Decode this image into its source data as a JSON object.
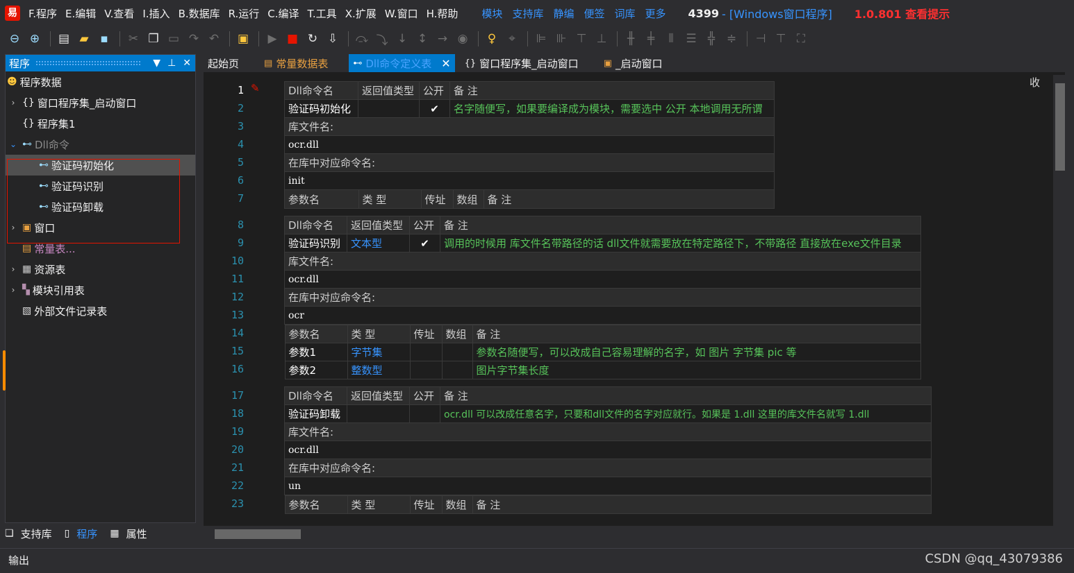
{
  "menubar": {
    "logo": "易",
    "items": [
      "F.程序",
      "E.编辑",
      "V.查看",
      "I.插入",
      "B.数据库",
      "R.运行",
      "C.编译",
      "T.工具",
      "X.扩展",
      "W.窗口",
      "H.帮助"
    ],
    "links": [
      "模块",
      "支持库",
      "静编",
      "便签",
      "词库",
      "更多"
    ],
    "title_num": "4399",
    "title_text": "- [Windows窗口程序]",
    "version": "1.0.801 查看提示"
  },
  "left_panel": {
    "title": "程序",
    "root": "程序数据",
    "items": [
      {
        "label": "窗口程序集_启动窗口",
        "icon": "{}"
      },
      {
        "label": "程序集1",
        "icon": "{}"
      },
      {
        "label": "Dll命令",
        "icon": "⊷"
      },
      {
        "label": "验证码初始化",
        "icon": "⊷"
      },
      {
        "label": "验证码识别",
        "icon": "⊷"
      },
      {
        "label": "验证码卸载",
        "icon": "⊷"
      },
      {
        "label": "窗口",
        "icon": "▣"
      },
      {
        "label": "常量表...",
        "icon": "▤"
      },
      {
        "label": "资源表",
        "icon": "▦"
      },
      {
        "label": "模块引用表",
        "icon": "▚"
      },
      {
        "label": "外部文件记录表",
        "icon": "▧"
      }
    ],
    "tabs": [
      "支持库",
      "程序",
      "属性"
    ]
  },
  "doc_tabs": [
    {
      "label": "起始页",
      "icon": ""
    },
    {
      "label": "常量数据表",
      "icon": "▤"
    },
    {
      "label": "Dll命令定义表",
      "icon": "⊷"
    },
    {
      "label": "窗口程序集_启动窗口",
      "icon": "{}"
    },
    {
      "label": "_启动窗口",
      "icon": "▣"
    }
  ],
  "editor": {
    "collapse_label": "收",
    "line_numbers": [
      "1",
      "2",
      "3",
      "4",
      "5",
      "6",
      "7",
      "8",
      "9",
      "10",
      "11",
      "12",
      "13",
      "14",
      "15",
      "16",
      "17",
      "18",
      "19",
      "20",
      "21",
      "22",
      "23"
    ],
    "headers": {
      "cmd": [
        "Dll命令名",
        "返回值类型",
        "公开",
        "备 注"
      ],
      "lib": "库文件名:",
      "entry": "在库中对应命令名:",
      "params": [
        "参数名",
        "类 型",
        "传址",
        "数组",
        "备 注"
      ]
    },
    "blocks": [
      {
        "name": "验证码初始化",
        "ret": "",
        "public": "✔",
        "note": "名字随便写，如果要编译成为模块，需要选中 公开 本地调用无所谓",
        "lib": "ocr.dll",
        "entry": "init",
        "params": []
      },
      {
        "name": "验证码识别",
        "ret": "文本型",
        "public": "✔",
        "note": "调用的时候用 库文件名带路径的话  dll文件就需要放在特定路径下，不带路径 直接放在exe文件目录",
        "lib": "ocr.dll",
        "entry": "ocr",
        "params": [
          {
            "name": "参数1",
            "type": "字节集",
            "note": "参数名随便写，可以改成自己容易理解的名字，如 图片 字节集 pic 等"
          },
          {
            "name": "参数2",
            "type": "整数型",
            "note": "图片字节集长度"
          }
        ]
      },
      {
        "name": "验证码卸载",
        "ret": "",
        "public": "",
        "note": "ocr.dll 可以改成任意名字，只要和dll文件的名字对应就行。如果是 1.dll 这里的库文件名就写 1.dll",
        "lib": "ocr.dll",
        "entry": "un",
        "params": []
      }
    ]
  },
  "bottom": {
    "output": "输出",
    "watermark": "CSDN @qq_43079386"
  }
}
